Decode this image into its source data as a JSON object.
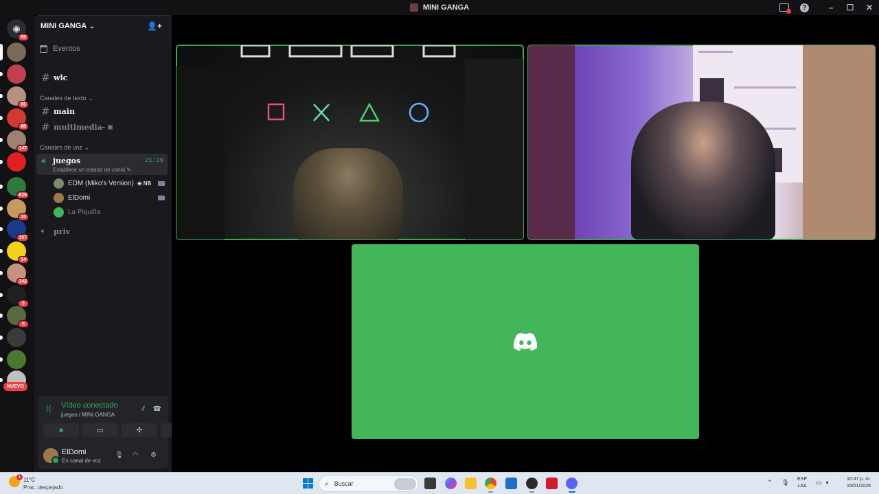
{
  "window": {
    "title": "MINI GANGA"
  },
  "server_rail": {
    "badges": [
      "59",
      "66",
      "88",
      "147",
      "626",
      "10",
      "167",
      "14",
      "142",
      "6",
      "5"
    ],
    "new_label": "NUEVO"
  },
  "guild": {
    "name": "MINI GANGA",
    "events_label": "Eventos",
    "channels": {
      "wlc": "wlc",
      "text_category": "Canales de texto",
      "main": "main",
      "multimedia": "multimedia-",
      "voice_category": "Canales de voz",
      "juegos": "juegos",
      "juegos_time": "21:19",
      "juegos_status": "Establece un estado de canal",
      "priv": "priv"
    },
    "voice_users": [
      {
        "name": "EDM (Miko's Version)",
        "tag": "NB"
      },
      {
        "name": "ElDomi"
      },
      {
        "name": "La Piquiña"
      }
    ]
  },
  "rtc": {
    "status": "Vídeo conectado",
    "location": "juegos / MINI GANGA"
  },
  "user": {
    "name": "ElDomi",
    "status": "En canal de voz"
  },
  "taskbar": {
    "weather_temp": "11°C",
    "weather_desc": "Prac. despejado",
    "weather_badge": "1",
    "search_placeholder": "Buscar",
    "lang_top": "ESP",
    "lang_bottom": "LAA",
    "time": "10:47 p. m.",
    "date": "15/01/2026"
  },
  "colors": {
    "accent_green": "#3ba55c",
    "tile_green": "#43b55b",
    "badge_red": "#f23f43",
    "sidebar_bg": "#1a1a1e",
    "rail_bg": "#121214"
  }
}
